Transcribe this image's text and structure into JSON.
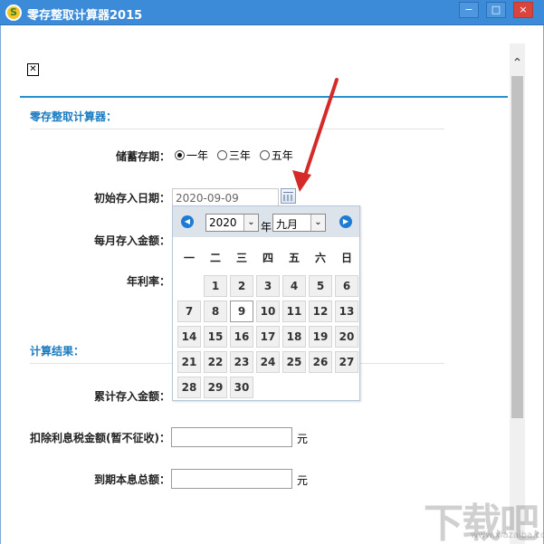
{
  "window": {
    "title": "零存整取计算器2015",
    "app_icon_glyph": "S",
    "minimize": "−",
    "maximize": "□",
    "close": "×"
  },
  "broken_image": "✕",
  "form": {
    "section_title": "零存整取计算器：",
    "term_label": "储蓄存期：",
    "term_options": [
      "一年",
      "三年",
      "五年"
    ],
    "term_selected": "一年",
    "start_date_label": "初始存入日期：",
    "start_date_value": "2020-09-09",
    "monthly_label": "每月存入金额：",
    "rate_label": "年利率："
  },
  "results": {
    "section_title": "计算结果：",
    "total_deposit_label": "累计存入金额：",
    "tax_label": "扣除利息税金额(暂不征收)：",
    "tax_unit": "元",
    "total_label": "到期本息总额：",
    "total_unit": "元"
  },
  "calendar": {
    "year": "2020",
    "year_suffix": "年",
    "month": "九月",
    "prev_icon": "◀",
    "next_icon": "▶",
    "dropdown_glyph": "⌄",
    "weekdays": [
      "一",
      "二",
      "三",
      "四",
      "五",
      "六",
      "日"
    ],
    "days": [
      "1",
      "2",
      "3",
      "4",
      "5",
      "6",
      "7",
      "8",
      "9",
      "10",
      "11",
      "12",
      "13",
      "14",
      "15",
      "16",
      "17",
      "18",
      "19",
      "20",
      "21",
      "22",
      "23",
      "24",
      "25",
      "26",
      "27",
      "28",
      "29",
      "30"
    ],
    "today": "9"
  },
  "scroll_up_glyph": "⌃",
  "watermark": "下载吧",
  "watermark_url": "www.xiazaiba.com",
  "colors": {
    "titlebar": "#3c8bd9",
    "accent": "#1b7bc0",
    "arrow": "#d42a2a"
  }
}
